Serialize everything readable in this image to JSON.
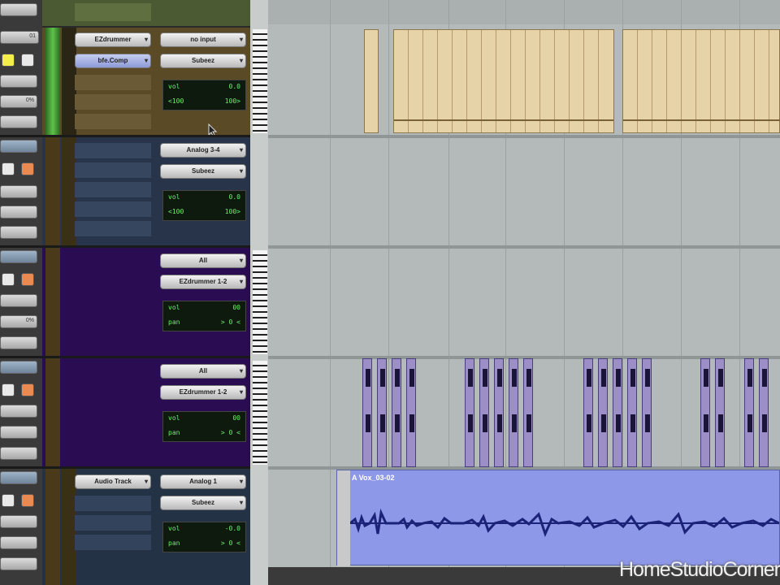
{
  "tracks": [
    {
      "name": "EZdrummer",
      "insert": "EZdrummer",
      "insert2": "bfe.Comp",
      "input": "no input",
      "output": "Subeez",
      "vol": "0.0",
      "pan_l": "<100",
      "pan_r": "100>"
    },
    {
      "input": "Analog 3-4",
      "output": "Subeez",
      "vol": "0.0",
      "pan_l": "<100",
      "pan_r": "100>"
    },
    {
      "input": "All",
      "output": "EZdrummer 1-2",
      "vol_label": "vol",
      "vol": "00",
      "pan_label": "pan",
      "pan": "> 0 <"
    },
    {
      "input": "All",
      "output": "EZdrummer 1-2",
      "vol_label": "vol",
      "vol": "00",
      "pan_label": "pan",
      "pan": "> 0 <"
    },
    {
      "insert": "Audio Track",
      "input": "Analog 1",
      "output": "Subeez",
      "vol_label": "vol",
      "vol": "-0.0",
      "pan_label": "pan",
      "pan": "> 0 <"
    }
  ],
  "left_column": {
    "track_number": "01",
    "value_a": "0%",
    "value_b": "0%"
  },
  "audio_region_name": "A Vox_03-02",
  "watermark": "HomeStudioCorner",
  "colors": {
    "track1": "#5a4a26",
    "track2": "#27344a",
    "track3": "#2a0c52",
    "track5": "#243246",
    "midi": "#e6d4a8",
    "hits": "#9c8fc8",
    "audio": "#8e98e8",
    "lane": "#b3bab9"
  }
}
